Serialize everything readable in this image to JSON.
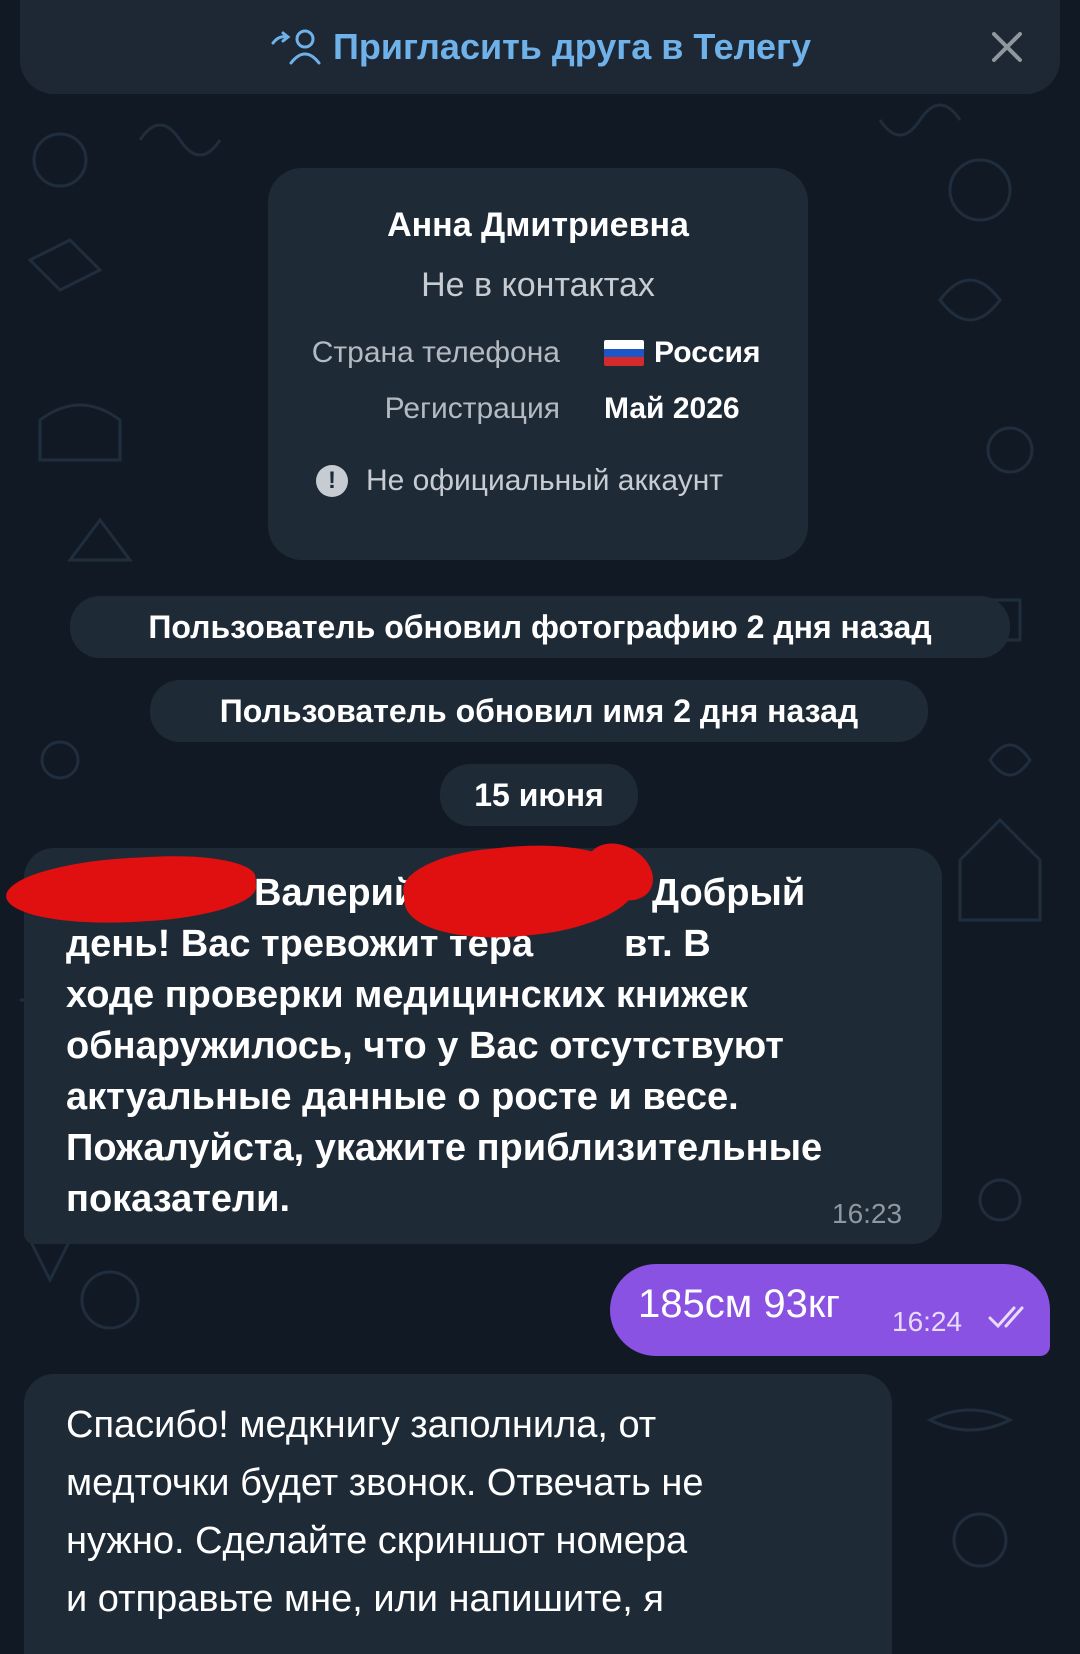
{
  "invite_bar": {
    "label": "Пригласить друга в Телегу"
  },
  "profile_card": {
    "name": "Анна Дмитриевна",
    "status": "Не в контактах",
    "phone_country_label": "Страна телефона",
    "phone_country_value": "Россия",
    "registration_label": "Регистрация",
    "registration_value": "Май 2026",
    "warning": "Не официальный аккаунт"
  },
  "service_messages": {
    "photo_updated": "Пользователь обновил фотографию 2 дня назад",
    "name_updated": "Пользователь обновил имя 2 дня назад",
    "date": "15 июня"
  },
  "messages": [
    {
      "lines": [
        "Валерий",
        "Добрый",
        "день! Вас тревожит тера",
        "вт. В",
        "ходе проверки медицинских книжек",
        "обнаружилось, что у Вас отсутствуют",
        "актуальные данные о росте и весе.",
        "Пожалуйста, укажите приблизительные",
        "показатели."
      ],
      "time": "16:23"
    },
    {
      "text": "185см 93кг",
      "time": "16:24"
    },
    {
      "lines": [
        "Спасибо! медкнигу заполнила, от",
        "медточки будет звонок. Отвечать не",
        "нужно. Сделайте скриншот номера",
        "и отправьте мне, или напишите, я"
      ]
    }
  ],
  "colors": {
    "background": "#111a24",
    "bubble_incoming": "#1f2a37",
    "bubble_outgoing": "#8a52e3",
    "link": "#6fb2ea",
    "redaction": "#e01010"
  },
  "icons": [
    "add-user-icon",
    "close-icon",
    "warning-icon",
    "russia-flag-icon",
    "double-check-icon"
  ]
}
